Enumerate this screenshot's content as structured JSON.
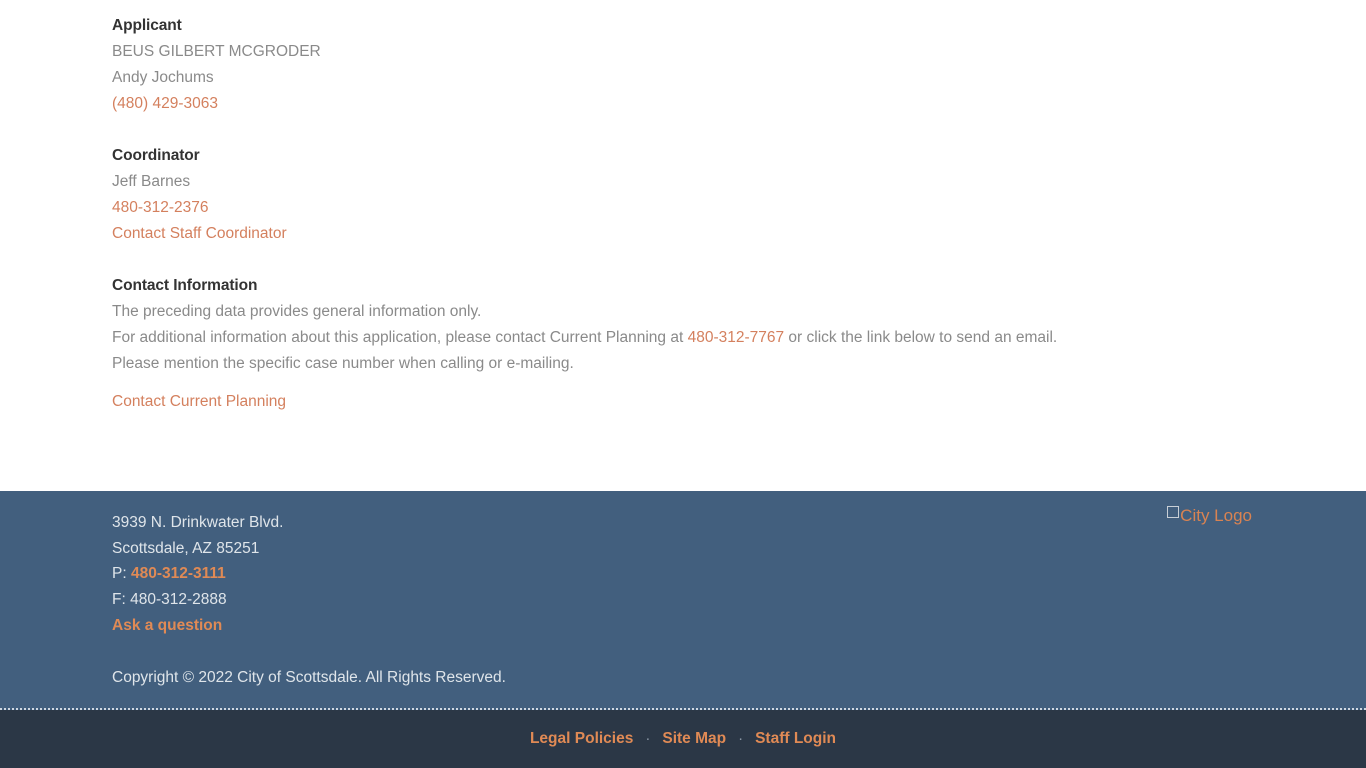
{
  "main": {
    "applicant": {
      "heading": "Applicant",
      "firm": "BEUS GILBERT MCGRODER",
      "contact_name": "Andy Jochums",
      "phone": "(480) 429-3063"
    },
    "coordinator": {
      "heading": "Coordinator",
      "name": "Jeff Barnes",
      "phone": "480-312-2376",
      "contact_link": "Contact Staff Coordinator"
    },
    "contact_information": {
      "heading": "Contact Information",
      "line1": "The preceding data provides general information only.",
      "line2_part1": "For additional information about this application, please contact Current Planning at",
      "line2_phone": "480-312-7767",
      "line2_part2": "or click the link below to send an email.",
      "line3": "Please mention the specific case number when calling or e-mailing.",
      "contact_link": "Contact Current Planning"
    }
  },
  "footer": {
    "address_line1": "3939 N. Drinkwater Blvd.",
    "address_line2": "Scottsdale, AZ 85251",
    "phone_label": "P:",
    "phone": "480-312-3111",
    "fax_line": "F: 480-312-2888",
    "ask_link": "Ask a question",
    "copyright": "Copyright © 2022 City of Scottsdale. All Rights Reserved.",
    "logo_alt": "City Logo"
  },
  "bottom_nav": {
    "items": [
      {
        "label": "Legal Policies"
      },
      {
        "label": "Site Map"
      },
      {
        "label": "Staff Login"
      }
    ],
    "separator": "·"
  },
  "colors": {
    "link_orange": "#d4805e",
    "footer_bg": "#425f7e",
    "bottombar_bg": "#2b3746",
    "footer_link": "#e08a55",
    "body_text": "#8a8a8a",
    "heading_text": "#333333"
  }
}
